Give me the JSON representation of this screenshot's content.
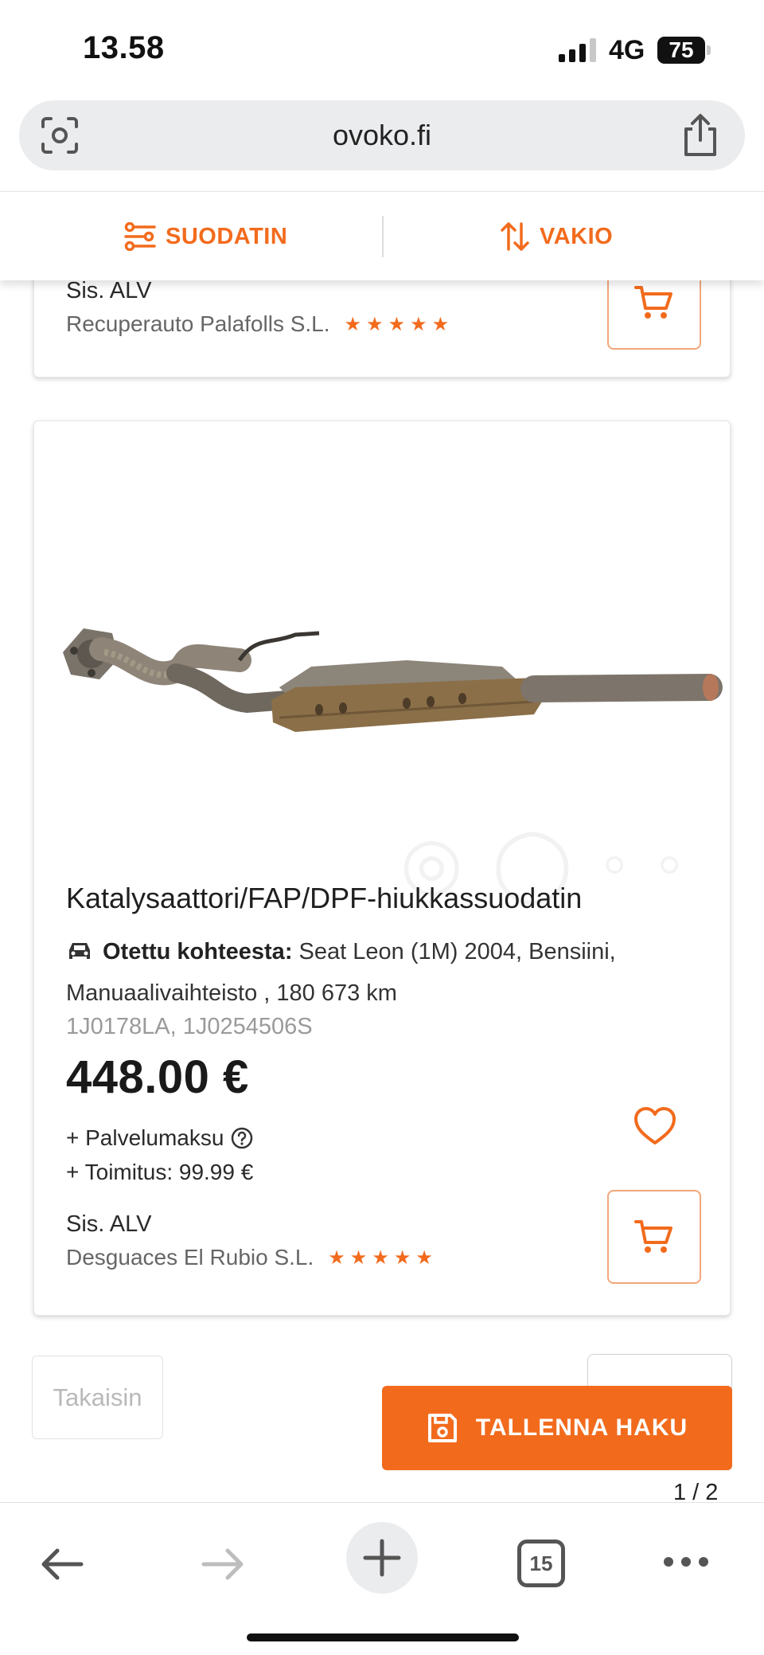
{
  "status_bar": {
    "time": "13.58",
    "network": "4G",
    "battery": "75"
  },
  "browser": {
    "url": "ovoko.fi",
    "open_tabs": "15"
  },
  "filter_bar": {
    "filter_label": "SUODATIN",
    "sort_label": "VAKIO"
  },
  "listings": [
    {
      "vat_label": "Sis. ALV",
      "seller": "Recuperauto Palafolls S.L.",
      "rating_stars": "★★★★★"
    },
    {
      "title": "Katalysaattori/FAP/DPF-hiukkassuodatin",
      "origin_label": "Otettu kohteesta:",
      "origin_value": "Seat Leon (1M) 2004, Bensiini, Manuaalivaihteisto , 180 673 km",
      "codes": "1J0178LA, 1J0254506S",
      "price": "448.00 €",
      "service_fee": "+ Palvelumaksu",
      "shipping": "+ Toimitus: 99.99 €",
      "vat_label": "Sis. ALV",
      "seller": "Desguaces El Rubio S.L.",
      "rating_stars": "★★★★★"
    }
  ],
  "pagination": {
    "back_label": "Takaisin",
    "page_indicator": "1 / 2"
  },
  "save_search": {
    "label": "TALLENNA HAKU"
  },
  "colors": {
    "accent": "#f26b1d",
    "text": "#222222",
    "muted": "#9a9a9a"
  }
}
